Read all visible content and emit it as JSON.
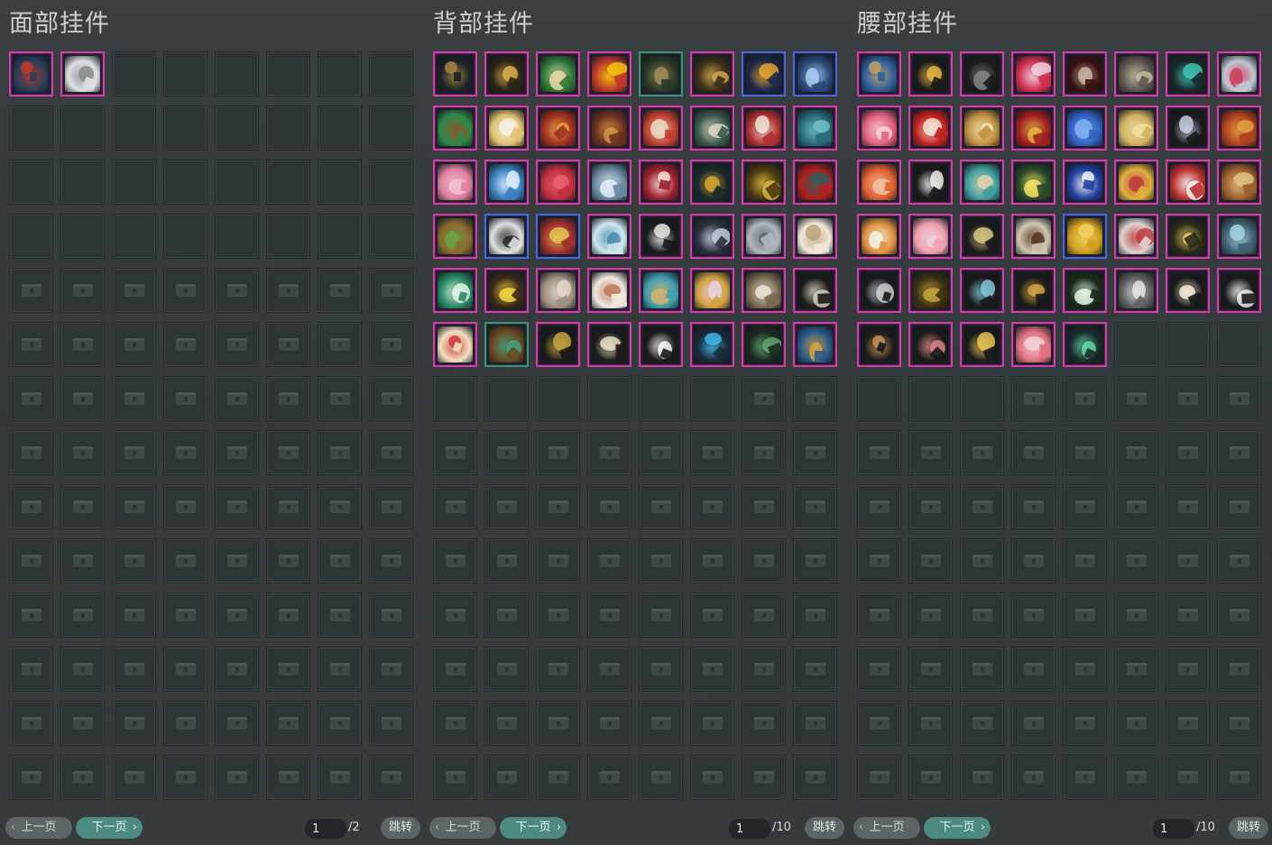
{
  "panels": [
    {
      "title": "面部挂件",
      "pagination": {
        "prev": "上一页",
        "next": "下一页",
        "page": "1",
        "total": "/2",
        "jump": "跳转"
      },
      "items": [
        {
          "icon": "red-mask-icon",
          "c1": "#2b3f5c",
          "c2": "#c0392b",
          "border": "pink"
        },
        {
          "icon": "silver-shield-mask-icon",
          "c1": "#e0e0e0",
          "c2": "#8a8f96",
          "border": "pink"
        }
      ],
      "empty_unlocked": 30
    },
    {
      "title": "背部挂件",
      "pagination": {
        "prev": "上一页",
        "next": "下一页",
        "page": "1",
        "total": "/10",
        "jump": "跳转"
      },
      "items": [
        {
          "icon": "black-dragon-icon",
          "c1": "#1d2228",
          "c2": "#a08040",
          "border": "pink"
        },
        {
          "icon": "golden-ornament-icon",
          "c1": "#2a2418",
          "c2": "#d4a84a",
          "border": "pink"
        },
        {
          "icon": "green-leaf-icon",
          "c1": "#2f7a3a",
          "c2": "#e7d4a5",
          "border": "pink"
        },
        {
          "icon": "parrot-icon",
          "c1": "#c0392b",
          "c2": "#f1c40f",
          "border": "pink"
        },
        {
          "icon": "fan-icon",
          "c1": "#2c3a28",
          "c2": "#9a8a5a",
          "border": "teal"
        },
        {
          "icon": "golden-triangle-icon",
          "c1": "#3a2e18",
          "c2": "#c9a24a",
          "border": "pink"
        },
        {
          "icon": "lute-icon",
          "c1": "#1e2a4a",
          "c2": "#e0a030",
          "border": "blue"
        },
        {
          "icon": "blue-orb-icon",
          "c1": "#2a4a7a",
          "c2": "#a8c8f0",
          "border": "blue"
        },
        {
          "icon": "jade-bag-icon",
          "c1": "#2e8a4a",
          "c2": "#8a5a30",
          "border": "pink"
        },
        {
          "icon": "golden-clock-icon",
          "c1": "#e0c070",
          "c2": "#f5f0e0",
          "border": "pink"
        },
        {
          "icon": "red-lantern-icon",
          "c1": "#a03020",
          "c2": "#e0a040",
          "border": "pink"
        },
        {
          "icon": "kite-icon",
          "c1": "#6a3020",
          "c2": "#d09040",
          "border": "pink"
        },
        {
          "icon": "red-fan-icon",
          "c1": "#c04030",
          "c2": "#e8d8c0",
          "border": "pink"
        },
        {
          "icon": "folding-screen-icon",
          "c1": "#3a5a4a",
          "c2": "#d8d0c0",
          "border": "pink"
        },
        {
          "icon": "red-drum-icon",
          "c1": "#b03030",
          "c2": "#e8e0d0",
          "border": "pink"
        },
        {
          "icon": "cyan-wing-icon",
          "c1": "#2a6a7a",
          "c2": "#6ac0c0",
          "border": "pink"
        },
        {
          "icon": "pink-coral-icon",
          "c1": "#e080a0",
          "c2": "#f0c0d0",
          "border": "pink"
        },
        {
          "icon": "snow-globe-icon",
          "c1": "#3a80c0",
          "c2": "#e0f0ff",
          "border": "pink"
        },
        {
          "icon": "red-pig-icon",
          "c1": "#c03040",
          "c2": "#e86070",
          "border": "pink"
        },
        {
          "icon": "cloud-disc-icon",
          "c1": "#6a8aa0",
          "c2": "#e0ecf5",
          "border": "pink"
        },
        {
          "icon": "flower-wreath-icon",
          "c1": "#a02030",
          "c2": "#f0e0d0",
          "border": "pink"
        },
        {
          "icon": "gold-sword-icon",
          "c1": "#1a2a2a",
          "c2": "#d0a030",
          "border": "pink"
        },
        {
          "icon": "golden-wreath-icon",
          "c1": "#4a3a10",
          "c2": "#d8b040",
          "border": "pink"
        },
        {
          "icon": "red-chest-icon",
          "c1": "#b02020",
          "c2": "#3a5a5a",
          "border": "pink"
        },
        {
          "icon": "basket-icon",
          "c1": "#8a6a30",
          "c2": "#6aa040",
          "border": "pink"
        },
        {
          "icon": "penguin-icon",
          "c1": "#e0e0e0",
          "c2": "#303030",
          "border": "blue"
        },
        {
          "icon": "star-hat-icon",
          "c1": "#a03030",
          "c2": "#e0c050",
          "border": "blue"
        },
        {
          "icon": "white-bird-icon",
          "c1": "#d0e8f0",
          "c2": "#5090b0",
          "border": "pink"
        },
        {
          "icon": "piano-keys-icon",
          "c1": "#1a1a1a",
          "c2": "#e0e0e0",
          "border": "pink"
        },
        {
          "icon": "silver-pendant-icon",
          "c1": "#2a3040",
          "c2": "#c0c8d8",
          "border": "pink"
        },
        {
          "icon": "silver-rabbit-icon",
          "c1": "#b0b8c0",
          "c2": "#606870",
          "border": "pink"
        },
        {
          "icon": "seashell-icon",
          "c1": "#f0e8d8",
          "c2": "#c0a880",
          "border": "pink"
        },
        {
          "icon": "green-bottle-icon",
          "c1": "#2a8a6a",
          "c2": "#e0f0e0",
          "border": "pink"
        },
        {
          "icon": "yellow-flower-icon",
          "c1": "#3a2a18",
          "c2": "#f0d040",
          "border": "pink"
        },
        {
          "icon": "feather-fan-icon",
          "c1": "#a09080",
          "c2": "#e0d8c8",
          "border": "pink"
        },
        {
          "icon": "white-rabbit-icon",
          "c1": "#f0e8e0",
          "c2": "#c08060",
          "border": "pink"
        },
        {
          "icon": "kingfisher-icon",
          "c1": "#40a0b0",
          "c2": "#d0b070",
          "border": "pink"
        },
        {
          "icon": "flower-bouquet-icon",
          "c1": "#d0a040",
          "c2": "#e8d0e0",
          "border": "pink"
        },
        {
          "icon": "dreamcatcher-icon",
          "c1": "#7a6a50",
          "c2": "#e8e0d0",
          "border": "pink"
        },
        {
          "icon": "wind-chime-icon",
          "c1": "#1a1a1a",
          "c2": "#d0c8b8",
          "border": "pink"
        },
        {
          "icon": "lucky-cat-icon",
          "c1": "#f0e0c0",
          "c2": "#d04040",
          "border": "pink"
        },
        {
          "icon": "scroll-book-icon",
          "c1": "#6a4a20",
          "c2": "#40a080",
          "border": "teal"
        },
        {
          "icon": "golden-phoenix-icon",
          "c1": "#1a1a1a",
          "c2": "#c0a040",
          "border": "pink"
        },
        {
          "icon": "hanging-scroll-icon",
          "c1": "#1a1a1a",
          "c2": "#e0d8c0",
          "border": "pink"
        },
        {
          "icon": "white-lantern-icon",
          "c1": "#1a1a1a",
          "c2": "#f0f0f0",
          "border": "pink"
        },
        {
          "icon": "blue-gourd-icon",
          "c1": "#1a2a3a",
          "c2": "#40b0e0",
          "border": "pink"
        },
        {
          "icon": "green-spirit-icon",
          "c1": "#1a2a20",
          "c2": "#60a070",
          "border": "pink"
        },
        {
          "icon": "treasure-chest-icon",
          "c1": "#2a5a8a",
          "c2": "#d0a040",
          "border": "pink"
        }
      ],
      "empty_unlocked": 6
    },
    {
      "title": "腰部挂件",
      "pagination": {
        "prev": "上一页",
        "next": "下一页",
        "page": "1",
        "total": "/10",
        "jump": "跳转"
      },
      "items": [
        {
          "icon": "blue-tassel-icon",
          "c1": "#3060a0",
          "c2": "#c0a060",
          "border": "pink"
        },
        {
          "icon": "golden-sword-pendant-icon",
          "c1": "#1a1a1a",
          "c2": "#e0b040",
          "border": "pink"
        },
        {
          "icon": "black-feather-icon",
          "c1": "#1a1a1a",
          "c2": "#808080",
          "border": "pink"
        },
        {
          "icon": "red-knot-icon",
          "c1": "#d03050",
          "c2": "#f0d0e0",
          "border": "pink"
        },
        {
          "icon": "red-dagger-icon",
          "c1": "#3a1010",
          "c2": "#c0b0a0",
          "border": "pink"
        },
        {
          "icon": "bronze-mirror-icon",
          "c1": "#605850",
          "c2": "#c0b8a0",
          "border": "pink"
        },
        {
          "icon": "bird-perch-icon",
          "c1": "#1a2a2a",
          "c2": "#40c0b0",
          "border": "pink"
        },
        {
          "icon": "silver-charm-icon",
          "c1": "#c0c8d0",
          "c2": "#d04060",
          "border": "pink"
        },
        {
          "icon": "plum-blossom-icon",
          "c1": "#e06080",
          "c2": "#f0d0d8",
          "border": "pink"
        },
        {
          "icon": "red-disc-icon",
          "c1": "#c02020",
          "c2": "#f0e0d0",
          "border": "pink"
        },
        {
          "icon": "golden-gourd-icon",
          "c1": "#c09040",
          "c2": "#f0e0b0",
          "border": "pink"
        },
        {
          "icon": "red-amulet-icon",
          "c1": "#a02020",
          "c2": "#e0b040",
          "border": "pink"
        },
        {
          "icon": "blue-crystal-icon",
          "c1": "#3060c0",
          "c2": "#80b0f0",
          "border": "pink"
        },
        {
          "icon": "golden-egg-icon",
          "c1": "#d0b060",
          "c2": "#f0e0a0",
          "border": "pink"
        },
        {
          "icon": "silver-flask-icon",
          "c1": "#1a1a1a",
          "c2": "#c0c8d8",
          "border": "pink"
        },
        {
          "icon": "red-feather-icon",
          "c1": "#b04020",
          "c2": "#e0a040",
          "border": "pink"
        },
        {
          "icon": "orange-flower-icon",
          "c1": "#e06030",
          "c2": "#f0c0a0",
          "border": "pink"
        },
        {
          "icon": "crescent-moon-icon",
          "c1": "#1a1a1a",
          "c2": "#e8e8e8",
          "border": "pink"
        },
        {
          "icon": "teal-drum-icon",
          "c1": "#40a0a0",
          "c2": "#e0d0b0",
          "border": "pink"
        },
        {
          "icon": "yellow-bloom-icon",
          "c1": "#2a4a2a",
          "c2": "#f0e060",
          "border": "pink"
        },
        {
          "icon": "blue-vase-icon",
          "c1": "#2040a0",
          "c2": "#f0f0f0",
          "border": "pink"
        },
        {
          "icon": "flower-fairy-icon",
          "c1": "#e0b040",
          "c2": "#c04040",
          "border": "pink"
        },
        {
          "icon": "red-cylinder-icon",
          "c1": "#c03030",
          "c2": "#f0f0f0",
          "border": "pink"
        },
        {
          "icon": "wooden-doll-icon",
          "c1": "#a06030",
          "c2": "#e0c080",
          "border": "pink"
        },
        {
          "icon": "hamster-icon",
          "c1": "#e09040",
          "c2": "#f0f0e0",
          "border": "pink"
        },
        {
          "icon": "pink-pig-icon",
          "c1": "#f0a0b0",
          "c2": "#f0d0d8",
          "border": "pink"
        },
        {
          "icon": "jade-hook-icon",
          "c1": "#1a1a1a",
          "c2": "#d0c080",
          "border": "pink"
        },
        {
          "icon": "book-charm-icon",
          "c1": "#d0c8b0",
          "c2": "#5a3a2a",
          "border": "pink"
        },
        {
          "icon": "gold-ingot-icon",
          "c1": "#d0a020",
          "c2": "#f0d060",
          "border": "blue"
        },
        {
          "icon": "panda-trio-icon",
          "c1": "#e0d0d0",
          "c2": "#c04040",
          "border": "pink"
        },
        {
          "icon": "golden-table-icon",
          "c1": "#2a2a1a",
          "c2": "#e0c060",
          "border": "pink"
        },
        {
          "icon": "jade-pouch-icon",
          "c1": "#406070",
          "c2": "#a0d0e0",
          "border": "pink"
        },
        {
          "icon": "silver-knot-icon",
          "c1": "#1a1a1a",
          "c2": "#c0c8d0",
          "border": "pink"
        },
        {
          "icon": "golden-flute-icon",
          "c1": "#3a3010",
          "c2": "#c0a040",
          "border": "pink"
        },
        {
          "icon": "crystal-ball-icon",
          "c1": "#1a1a1a",
          "c2": "#80c0d0",
          "border": "pink"
        },
        {
          "icon": "golden-knot-icon",
          "c1": "#1a1a1a",
          "c2": "#d0a040",
          "border": "pink"
        },
        {
          "icon": "white-lily-icon",
          "c1": "#1a2a1a",
          "c2": "#e0f0e0",
          "border": "pink"
        },
        {
          "icon": "silver-ring-icon",
          "c1": "#606060",
          "c2": "#e0e0e0",
          "border": "pink"
        },
        {
          "icon": "pearl-shell-icon",
          "c1": "#1a1a1a",
          "c2": "#f0e8d0",
          "border": "pink"
        },
        {
          "icon": "white-tassel-icon",
          "c1": "#1a1a1a",
          "c2": "#e8e8e8",
          "border": "pink"
        },
        {
          "icon": "bead-string-icon",
          "c1": "#1a1a1a",
          "c2": "#c09050",
          "border": "pink"
        },
        {
          "icon": "dancer-charm-icon",
          "c1": "#1a1a1a",
          "c2": "#d08080",
          "border": "pink"
        },
        {
          "icon": "golden-beads-icon",
          "c1": "#1a1a1a",
          "c2": "#e0c050",
          "border": "pink"
        },
        {
          "icon": "pink-swirl-icon",
          "c1": "#e07080",
          "c2": "#f0d0d8",
          "border": "pink"
        },
        {
          "icon": "green-dragon-icon",
          "c1": "#1a2a2a",
          "c2": "#60d0a0",
          "border": "pink"
        }
      ],
      "empty_unlocked": 6
    }
  ],
  "colors": {
    "pink_border": "#cf3fa8",
    "blue_border": "#4a66d8",
    "teal_border": "#3f8f7a",
    "next_button": "#4d8a80"
  }
}
